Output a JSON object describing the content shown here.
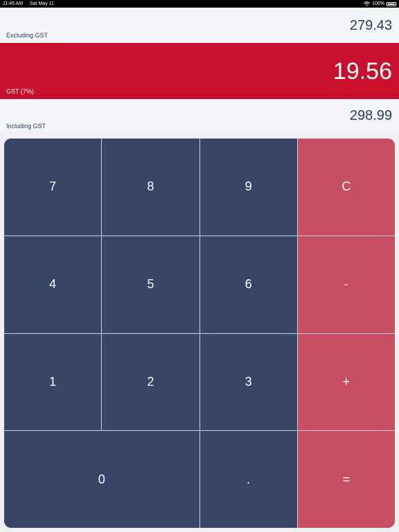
{
  "status_bar": {
    "time": "11:45 AM",
    "date": "Sat May 11",
    "battery": "100%"
  },
  "excluding": {
    "label": "Excluding GST",
    "value": "279.43"
  },
  "gst": {
    "label": "GST (7%)",
    "value": "19.56"
  },
  "including": {
    "label": "Including GST",
    "value": "298.99"
  },
  "keys": {
    "k7": "7",
    "k8": "8",
    "k9": "9",
    "clear": "C",
    "k4": "4",
    "k5": "5",
    "k6": "6",
    "minus": "-",
    "k1": "1",
    "k2": "2",
    "k3": "3",
    "plus": "+",
    "k0": "0",
    "dot": ".",
    "equals": "="
  },
  "colors": {
    "gst_band": "#c8102e",
    "digit_key": "#374567",
    "operator_key": "#c84f62",
    "text_dark": "#2d3b63"
  },
  "icons": [
    "wifi-icon",
    "battery-icon"
  ]
}
